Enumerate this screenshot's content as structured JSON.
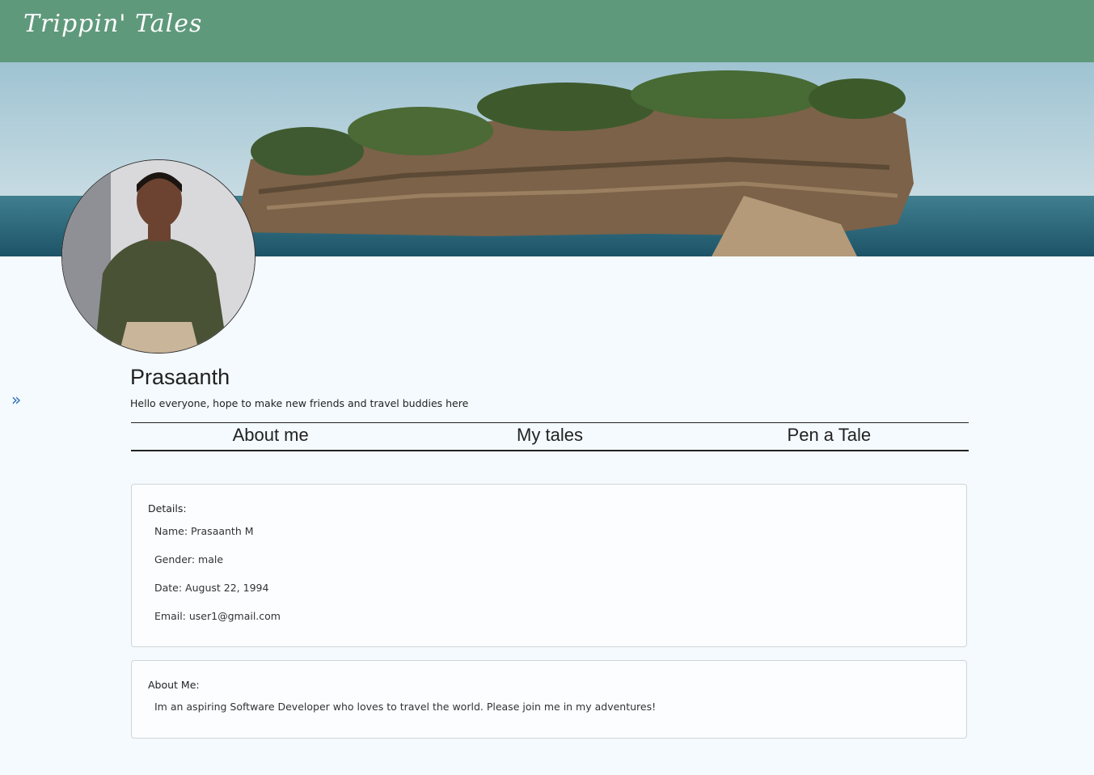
{
  "app": {
    "brand": "Trippin' Tales"
  },
  "profile": {
    "name": "Prasaanth",
    "bio": "Hello everyone, hope to make new friends and travel buddies here"
  },
  "tabs": [
    {
      "label": "About me"
    },
    {
      "label": "My tales"
    },
    {
      "label": "Pen a Tale"
    }
  ],
  "details": {
    "title": "Details:",
    "name": "Name: Prasaanth M",
    "gender": "Gender: male",
    "date": "Date: August 22, 1994",
    "email": "Email: user1@gmail.com"
  },
  "about": {
    "title": "About Me:",
    "text": "Im an aspiring Software Developer who loves to travel the world. Please join me in my adventures!"
  },
  "icons": {
    "sidebar_toggle": "double-chevron-right-icon"
  },
  "colors": {
    "navbar": "#5f997b",
    "background": "#f4fafd",
    "accent": "#2f6fbf"
  }
}
